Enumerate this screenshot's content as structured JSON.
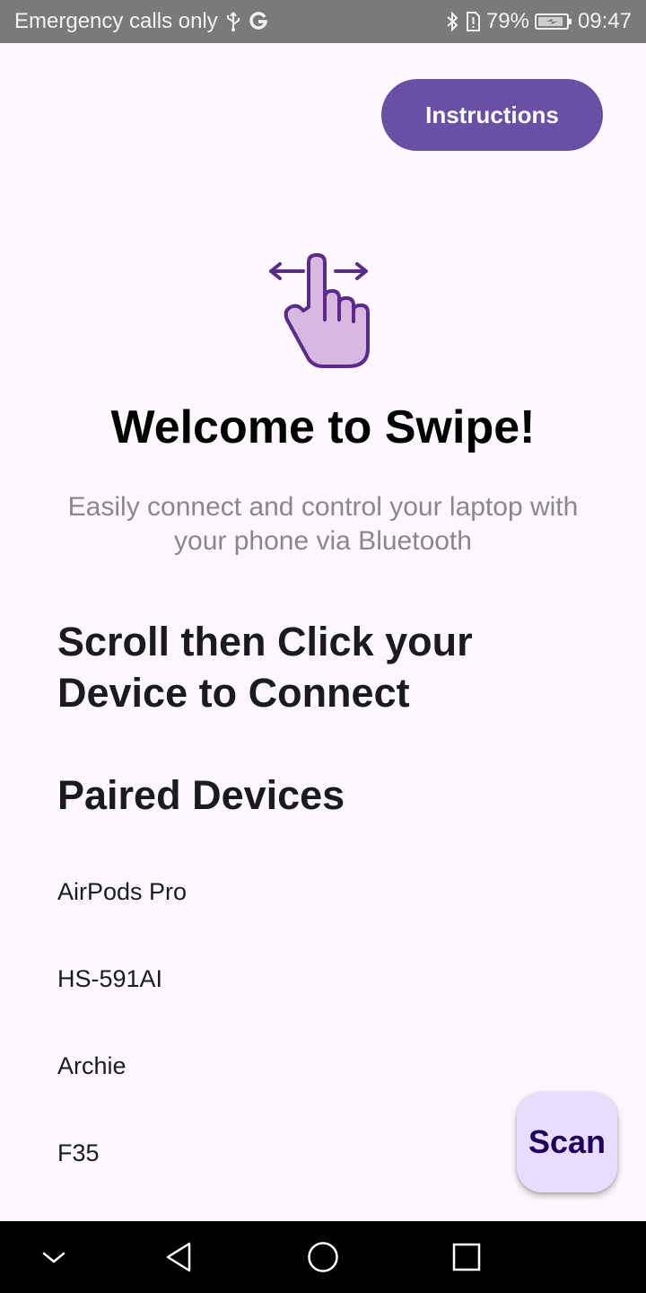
{
  "status_bar": {
    "carrier_text": "Emergency calls only",
    "battery_percent": "79%",
    "time": "09:47",
    "icons": [
      "usb-icon",
      "google-icon",
      "bluetooth-icon",
      "sim-alert-icon",
      "battery-charging-icon"
    ]
  },
  "header": {
    "instructions_label": "Instructions"
  },
  "hero": {
    "icon": "swipe-hand-icon",
    "title": "Welcome to Swipe!",
    "subtitle": "Easily connect and control your laptop with your phone via Bluetooth"
  },
  "main": {
    "scroll_prompt": "Scroll then Click your Device to Connect",
    "paired_title": "Paired Devices",
    "devices": [
      {
        "name": "AirPods Pro"
      },
      {
        "name": "HS-591AI"
      },
      {
        "name": "Archie"
      },
      {
        "name": "F35"
      }
    ]
  },
  "fab": {
    "scan_label": "Scan"
  },
  "nav_bar": {
    "icons": [
      "nav-collapse-icon",
      "back-icon",
      "home-icon",
      "recents-icon"
    ]
  },
  "colors": {
    "accent": "#6a4fa6",
    "fab_bg": "#e9ddff",
    "fab_text": "#21005d",
    "background": "#fdf8fd",
    "subtitle_text": "#8a878c"
  }
}
